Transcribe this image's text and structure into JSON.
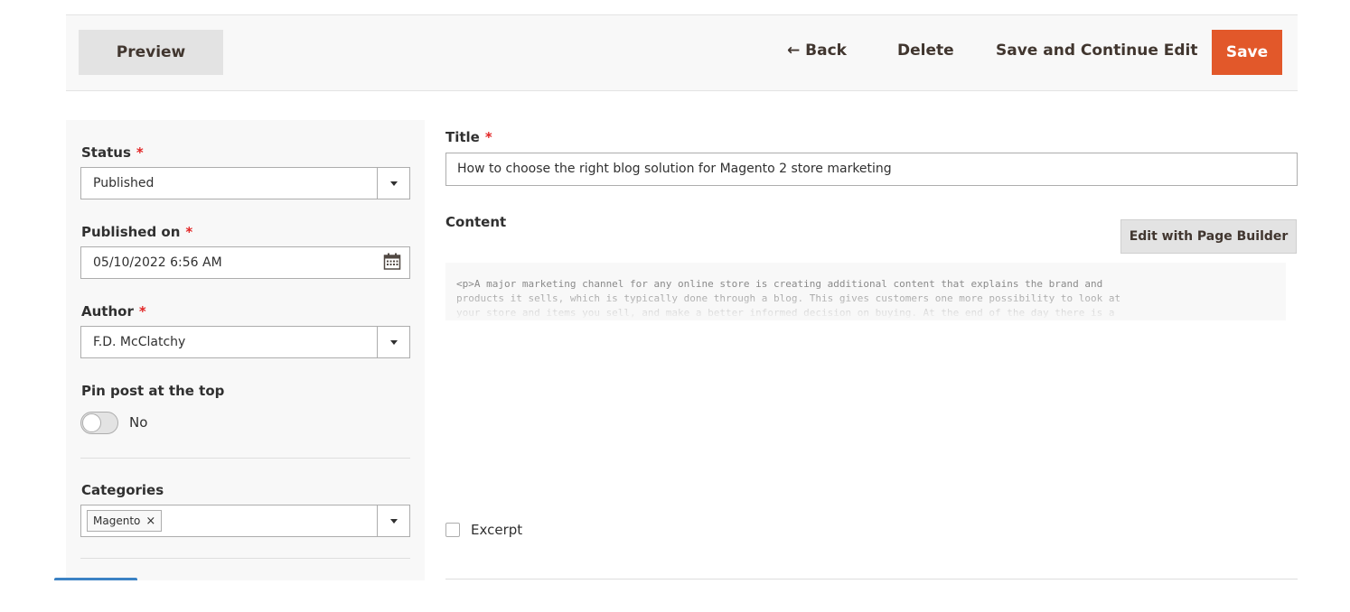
{
  "toolbar": {
    "preview_label": "Preview",
    "back_label": "← Back",
    "delete_label": "Delete",
    "save_continue_label": "Save and Continue Edit",
    "save_label": "Save",
    "accent_color": "#e2582a"
  },
  "sidebar": {
    "status": {
      "label": "Status",
      "required_mark": "*",
      "value": "Published"
    },
    "published_on": {
      "label": "Published on",
      "required_mark": "*",
      "value": "05/10/2022 6:56 AM",
      "icon": "calendar-icon"
    },
    "author": {
      "label": "Author",
      "required_mark": "*",
      "value": "F.D. McClatchy"
    },
    "pin": {
      "label": "Pin post at the top",
      "state_text": "No",
      "enabled": false
    },
    "categories": {
      "label": "Categories",
      "tags": [
        {
          "text": "Magento",
          "remove": "×"
        }
      ]
    }
  },
  "main": {
    "title": {
      "label": "Title",
      "required_mark": "*",
      "value": "How to choose the right blog solution for Magento 2 store marketing"
    },
    "content": {
      "label": "Content",
      "page_builder_label": "Edit with Page Builder",
      "html_preview": "<p>A major marketing channel for any online store is creating additional content that explains the brand and\nproducts it sells, which is typically done through a blog. This gives customers one more possibility to look at\nyour store and items you sell, and make a better informed decision on buying. At the end of the day there is a"
    },
    "excerpt": {
      "label": "Excerpt",
      "checked": false
    }
  }
}
